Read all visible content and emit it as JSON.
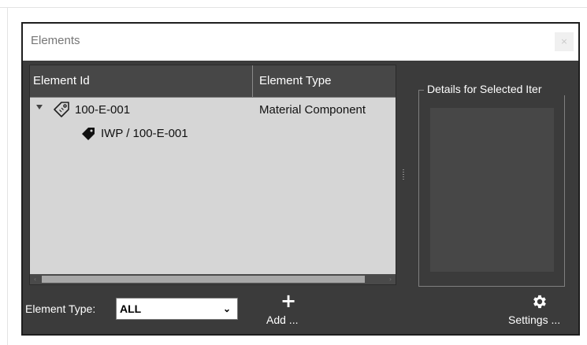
{
  "window": {
    "title": "Elements",
    "close_glyph": "×"
  },
  "grid": {
    "columns": [
      "Element Id",
      "Element Type"
    ],
    "rows": [
      {
        "id": "100-E-001",
        "type": "Material Component",
        "icon": "tag-outline-icon",
        "expanded": true
      },
      {
        "id": "IWP / 100-E-001",
        "type": "",
        "icon": "tag-solid-icon",
        "child": true
      }
    ]
  },
  "details": {
    "legend": "Details for Selected Iter"
  },
  "filter": {
    "label": "Element Type:",
    "selected": "ALL",
    "chevron": "⌄"
  },
  "toolbar": {
    "add_label": "Add ...",
    "add_glyph": "+",
    "settings_label": "Settings ..."
  }
}
